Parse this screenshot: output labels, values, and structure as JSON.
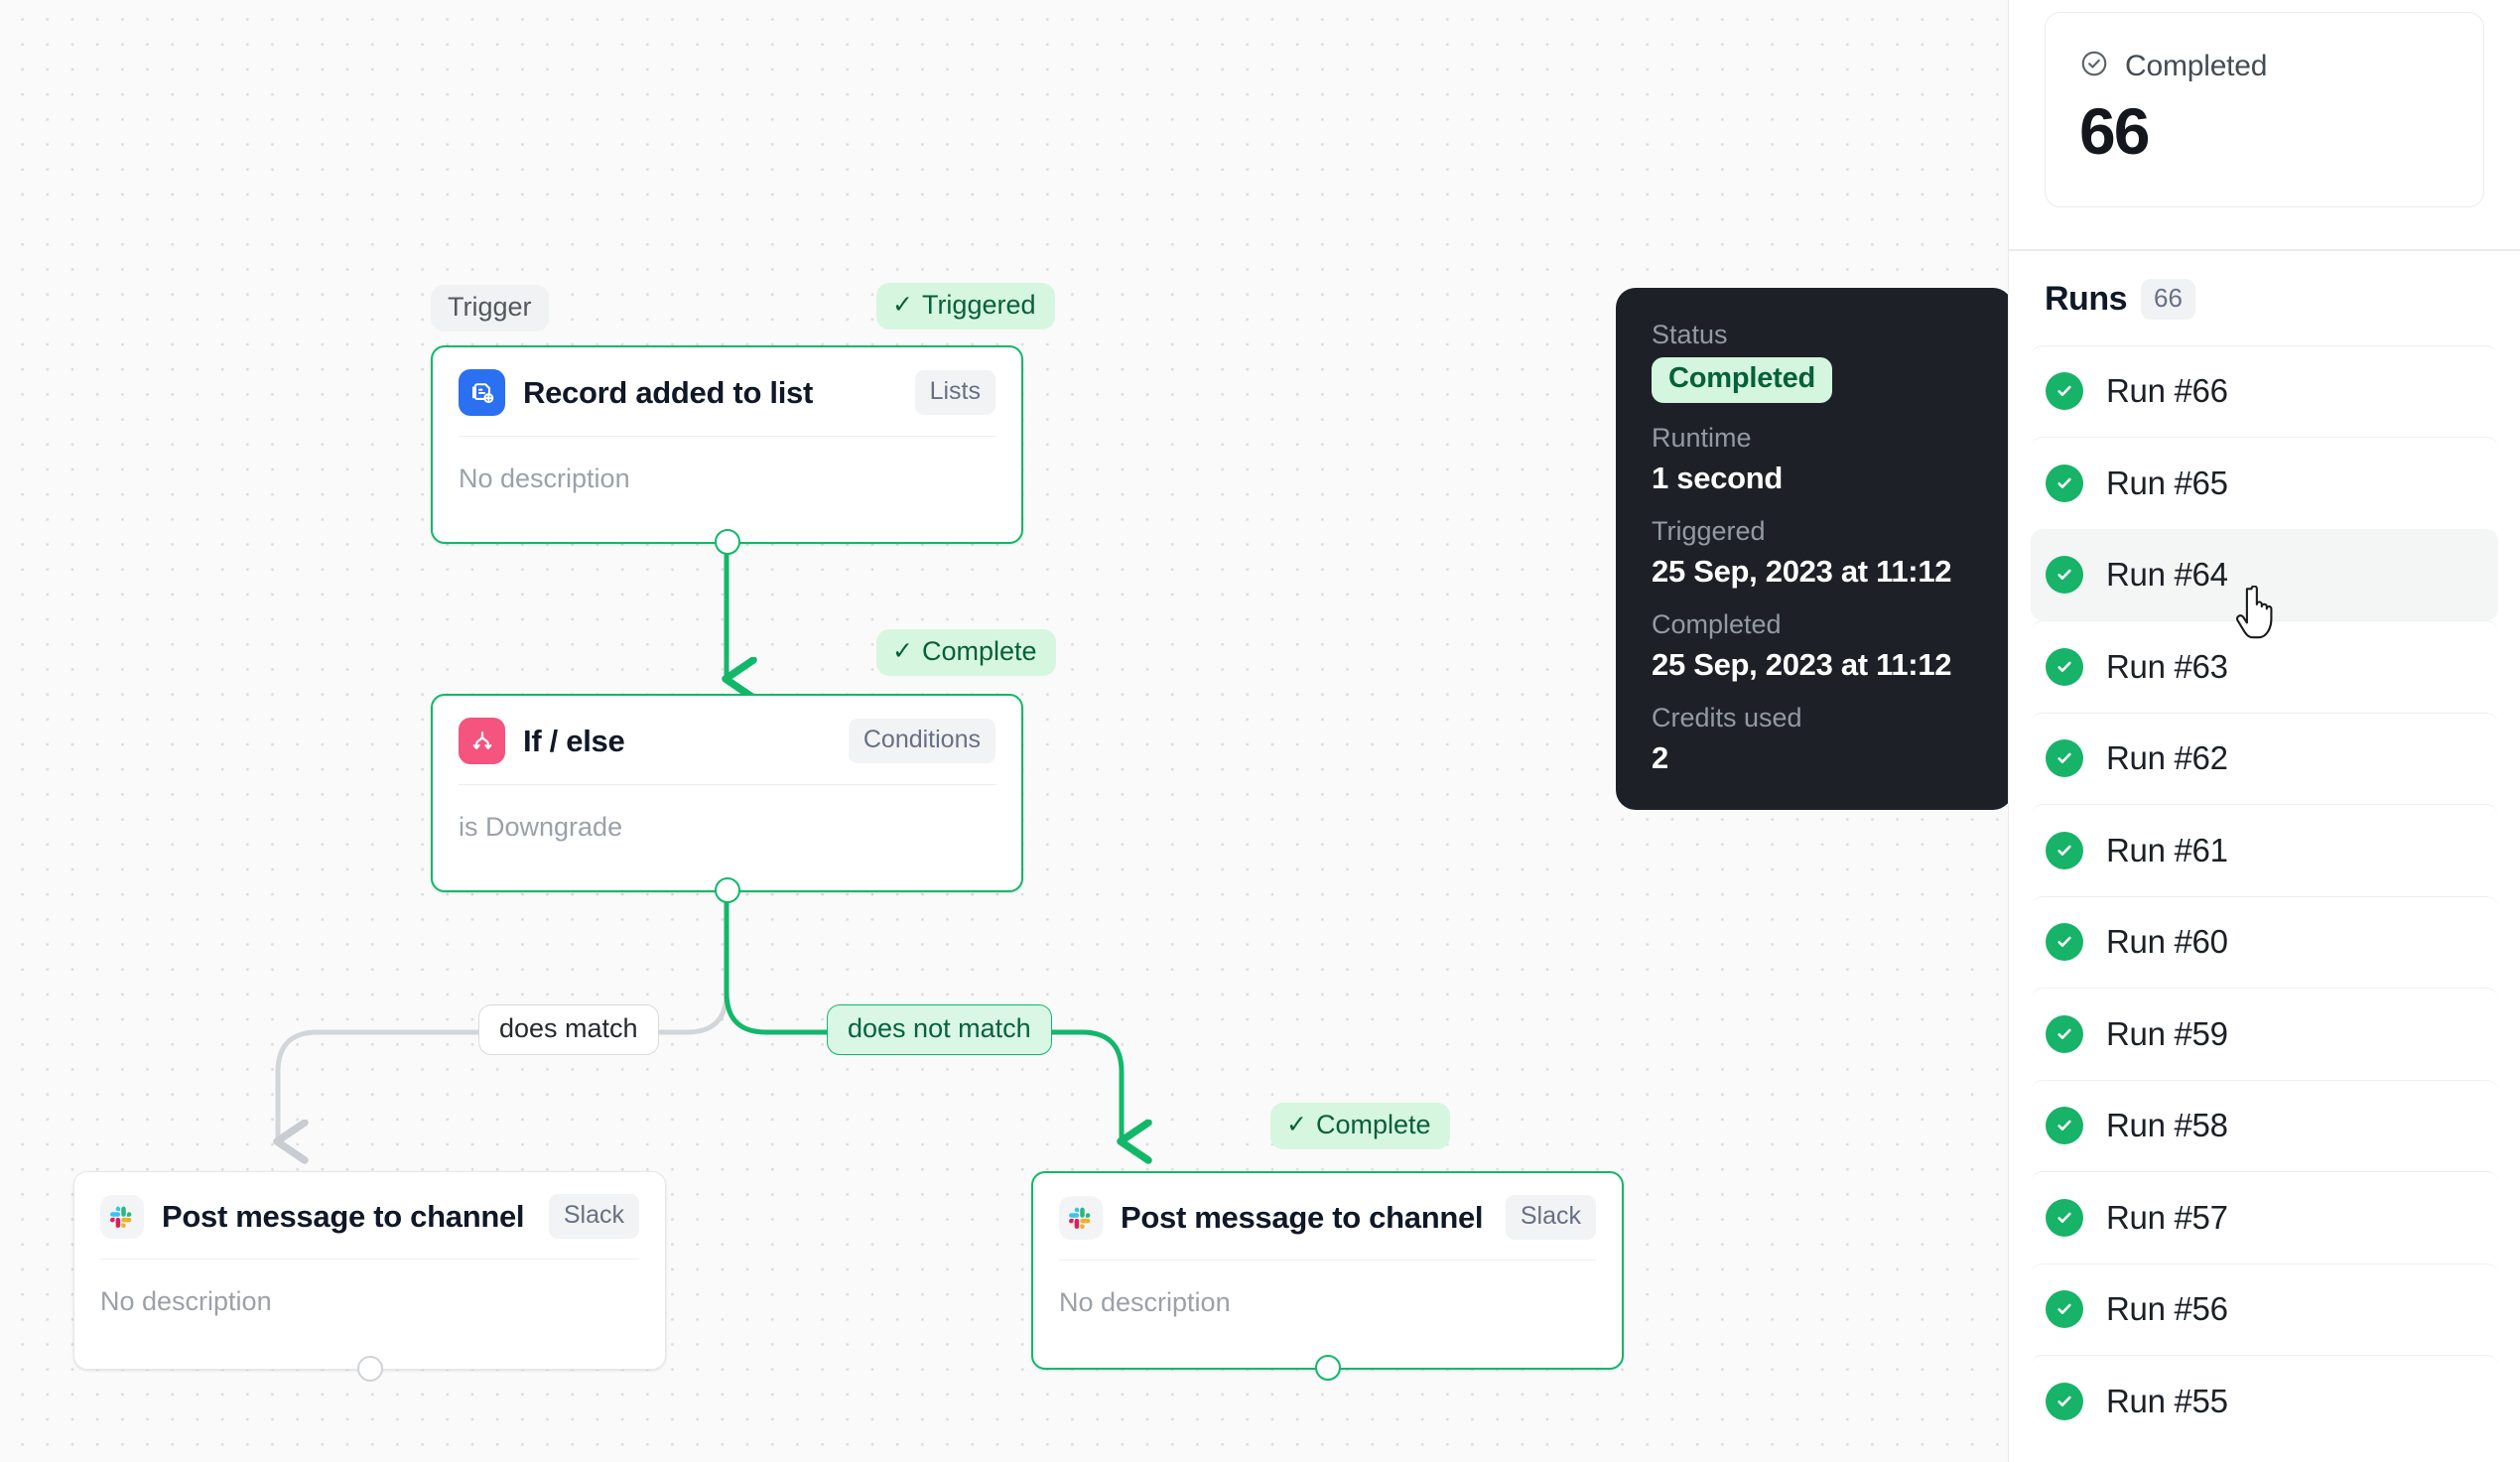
{
  "canvas": {
    "nodes": [
      {
        "id": "trigger",
        "title": "Record added to list",
        "tag": "Lists",
        "description": "No description",
        "kind_pill": "Trigger",
        "status_badge": "Triggered",
        "icon": "record-add-icon",
        "icon_color": "#2a70f0"
      },
      {
        "id": "condition",
        "title": "If / else",
        "tag": "Conditions",
        "description": "is Downgrade",
        "status_badge": "Complete",
        "icon": "branch-split-icon",
        "icon_color": "#f4547e"
      },
      {
        "id": "slack-left",
        "title": "Post message to channel",
        "tag": "Slack",
        "description": "No description",
        "icon": "slack-icon"
      },
      {
        "id": "slack-right",
        "title": "Post message to channel",
        "tag": "Slack",
        "description": "No description",
        "status_badge": "Complete",
        "icon": "slack-icon"
      }
    ],
    "edge_labels": {
      "match": "does match",
      "no_match": "does not match"
    },
    "check_glyph": "✓",
    "colors": {
      "active_green": "#12b76a",
      "badge_green_bg": "#d6f6e0",
      "badge_green_text": "#06603a",
      "inactive_grey": "#cfd3d7"
    }
  },
  "details_popover": {
    "status_label": "Status",
    "status_value": "Completed",
    "runtime_label": "Runtime",
    "runtime_value": "1 second",
    "triggered_label": "Triggered",
    "triggered_value": "25 Sep, 2023 at 11:12",
    "completed_label": "Completed",
    "completed_value": "25 Sep, 2023 at 11:12",
    "credits_label": "Credits used",
    "credits_value": "2"
  },
  "sidebar": {
    "stat_card": {
      "icon": "check-circle-icon",
      "title": "Completed",
      "value": "66"
    },
    "runs_header": {
      "title": "Runs",
      "count": "66"
    },
    "runs": [
      {
        "label": "Run #66",
        "status": "success",
        "hovered": false
      },
      {
        "label": "Run #65",
        "status": "success",
        "hovered": false
      },
      {
        "label": "Run #64",
        "status": "success",
        "hovered": true
      },
      {
        "label": "Run #63",
        "status": "success",
        "hovered": false
      },
      {
        "label": "Run #62",
        "status": "success",
        "hovered": false
      },
      {
        "label": "Run #61",
        "status": "success",
        "hovered": false
      },
      {
        "label": "Run #60",
        "status": "success",
        "hovered": false
      },
      {
        "label": "Run #59",
        "status": "success",
        "hovered": false
      },
      {
        "label": "Run #58",
        "status": "success",
        "hovered": false
      },
      {
        "label": "Run #57",
        "status": "success",
        "hovered": false
      },
      {
        "label": "Run #56",
        "status": "success",
        "hovered": false
      },
      {
        "label": "Run #55",
        "status": "success",
        "hovered": false
      }
    ]
  }
}
